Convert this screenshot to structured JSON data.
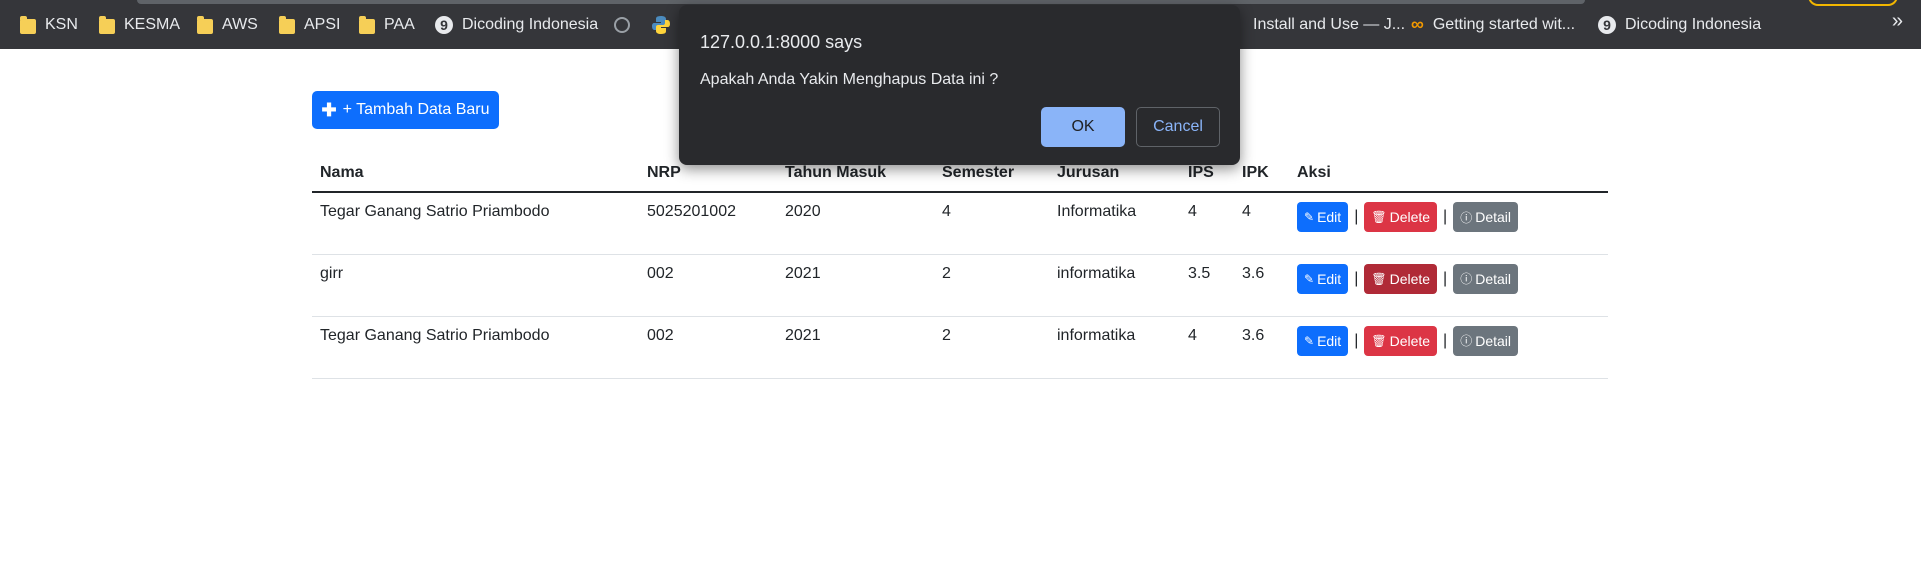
{
  "bookmarks": {
    "items": [
      {
        "label": "KSN",
        "icon": "folder-icon"
      },
      {
        "label": "KESMA",
        "icon": "folder-icon"
      },
      {
        "label": "AWS",
        "icon": "folder-icon"
      },
      {
        "label": "APSI",
        "icon": "folder-icon"
      },
      {
        "label": "PAA",
        "icon": "folder-icon"
      },
      {
        "label": "Dicoding Indonesia",
        "icon": "dicoding-icon"
      },
      {
        "label": "Install and Use — J...",
        "icon": "bookmark-icon"
      },
      {
        "label": "Getting started wit...",
        "icon": "infinity-icon"
      },
      {
        "label": "Dicoding Indonesia",
        "icon": "dicoding-icon"
      }
    ],
    "overflow": "»"
  },
  "page": {
    "add_button": "+ Tambah Data Baru",
    "table": {
      "headers": [
        "Nama",
        "NRP",
        "Tahun Masuk",
        "Semester",
        "Jurusan",
        "IPS",
        "IPK",
        "Aksi"
      ],
      "rows": [
        [
          "Tegar Ganang Satrio Priambodo",
          "5025201002",
          "2020",
          "4",
          "Informatika",
          "4",
          "4"
        ],
        [
          "girr",
          "002",
          "2021",
          "2",
          "informatika",
          "3.5",
          "3.6"
        ],
        [
          "Tegar Ganang Satrio Priambodo",
          "002",
          "2021",
          "2",
          "informatika",
          "4",
          "3.6"
        ]
      ],
      "actions": {
        "edit": "Edit",
        "delete": "Delete",
        "detail": "Detail",
        "separator": "|"
      }
    }
  },
  "dialog": {
    "title": "127.0.0.1:8000 says",
    "message": "Apakah Anda Yakin Menghapus Data ini ?",
    "ok": "OK",
    "cancel": "Cancel"
  },
  "colors": {
    "primary": "#0d6efd",
    "danger": "#dc3545",
    "secondary": "#6c757d",
    "dialog_bg": "#292a2d",
    "dialog_accent": "#8ab4f8"
  }
}
